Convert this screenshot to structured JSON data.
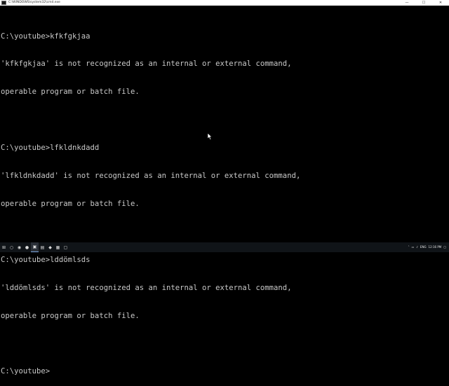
{
  "window": {
    "title": "C:\\WINDOWS\\system32\\cmd.exe",
    "minimize_glyph": "—",
    "maximize_glyph": "☐",
    "close_glyph": "✕"
  },
  "console": {
    "lines": [
      "C:\\youtube>kfkfgkjaa",
      "'kfkfgkjaa' is not recognized as an internal or external command,",
      "operable program or batch file.",
      "",
      "C:\\youtube>lfkldnkdadd",
      "'lfkldnkdadd' is not recognized as an internal or external command,",
      "operable program or batch file.",
      "",
      "C:\\youtube>lddömlsds",
      "'lddömlsds' is not recognized as an internal or external command,",
      "operable program or batch file.",
      "",
      "C:\\youtube>"
    ]
  },
  "taskbar": {
    "items": [
      {
        "name": "start-icon",
        "glyph": "⊞"
      },
      {
        "name": "search-icon",
        "glyph": "○"
      },
      {
        "name": "chrome-icon",
        "glyph": "◉"
      },
      {
        "name": "spotify-icon",
        "glyph": "●"
      },
      {
        "name": "cmd-icon",
        "glyph": "▣"
      },
      {
        "name": "app-icon",
        "glyph": "▤"
      },
      {
        "name": "app2-icon",
        "glyph": "◆"
      },
      {
        "name": "app3-icon",
        "glyph": "▦"
      },
      {
        "name": "app4-icon",
        "glyph": "▢"
      }
    ],
    "tray": {
      "language": "ENG",
      "time": "12:16 PM"
    }
  },
  "colors": {
    "console_bg": "#000000",
    "console_text": "#c8c8c8",
    "taskbar_bg": "#101418"
  }
}
